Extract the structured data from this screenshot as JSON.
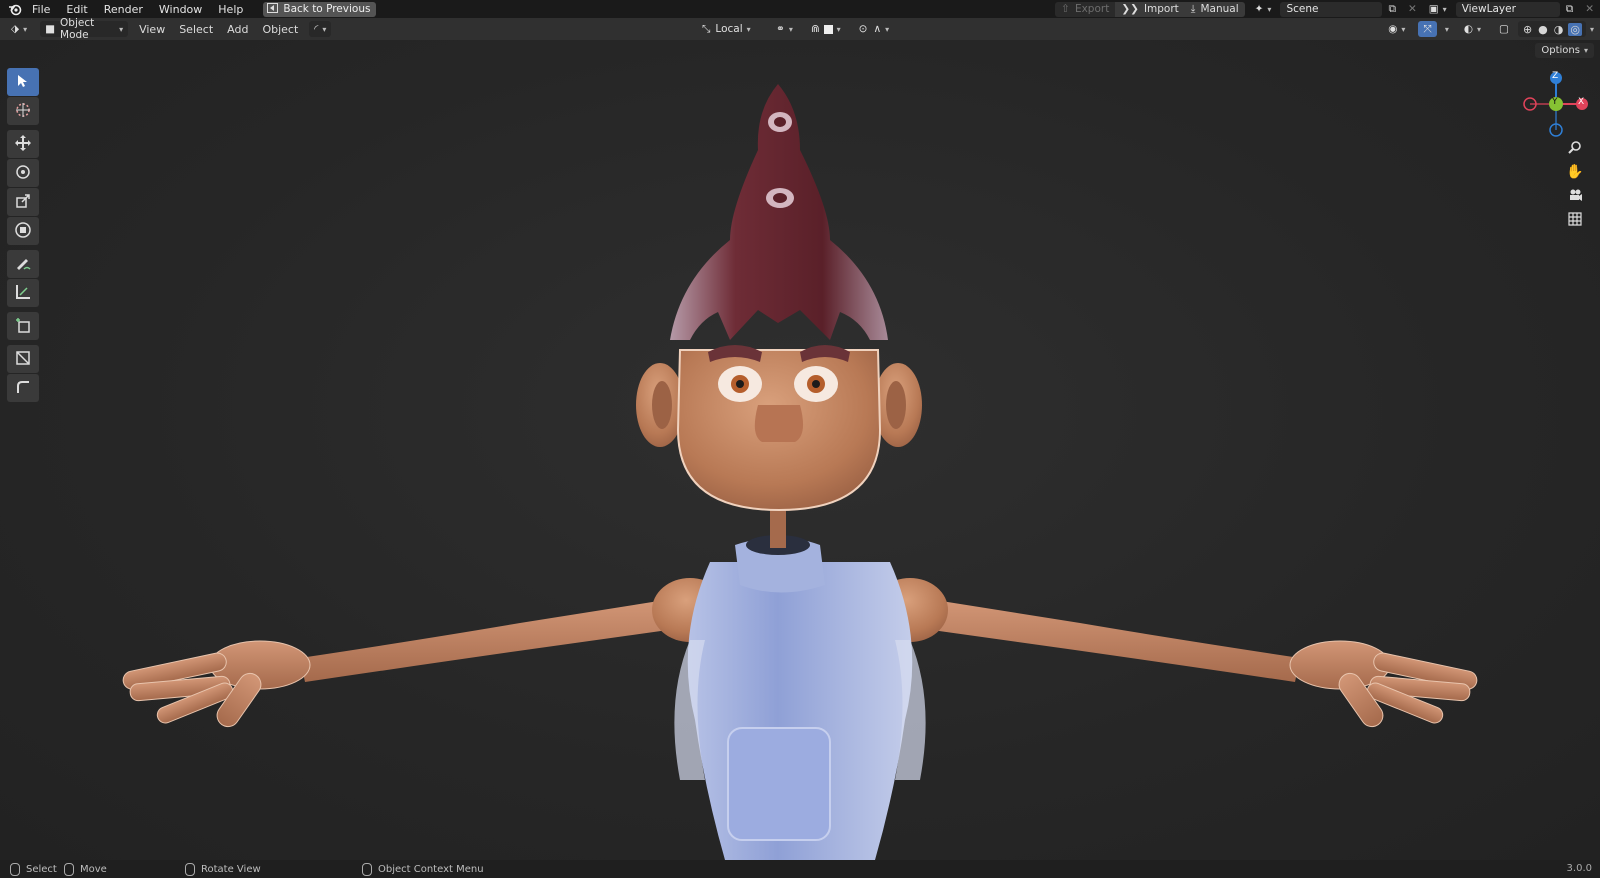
{
  "menu": {
    "file": "File",
    "edit": "Edit",
    "render": "Render",
    "window": "Window",
    "help": "Help",
    "back_to_previous": "Back to Previous"
  },
  "top_right": {
    "export": "Export",
    "import": "Import",
    "manual": "Manual",
    "scene": "Scene",
    "view_layer": "ViewLayer"
  },
  "header": {
    "mode": "Object Mode",
    "view": "View",
    "select": "Select",
    "add": "Add",
    "object": "Object",
    "transform_orientation": "Local",
    "options": "Options"
  },
  "gizmo": {
    "z": "Z",
    "y": "Y",
    "x": "X"
  },
  "statusbar": {
    "select": "Select",
    "move": "Move",
    "rotate_view": "Rotate View",
    "object_context_menu": "Object Context Menu",
    "version": "3.0.0"
  },
  "colors": {
    "accent": "#4772b3",
    "axis_x": "#e0435a",
    "axis_y": "#86c233",
    "axis_z": "#2f7fd6",
    "skin": "#c98a68",
    "hair": "#6a2a32",
    "shirt": "#8fa3d6"
  }
}
